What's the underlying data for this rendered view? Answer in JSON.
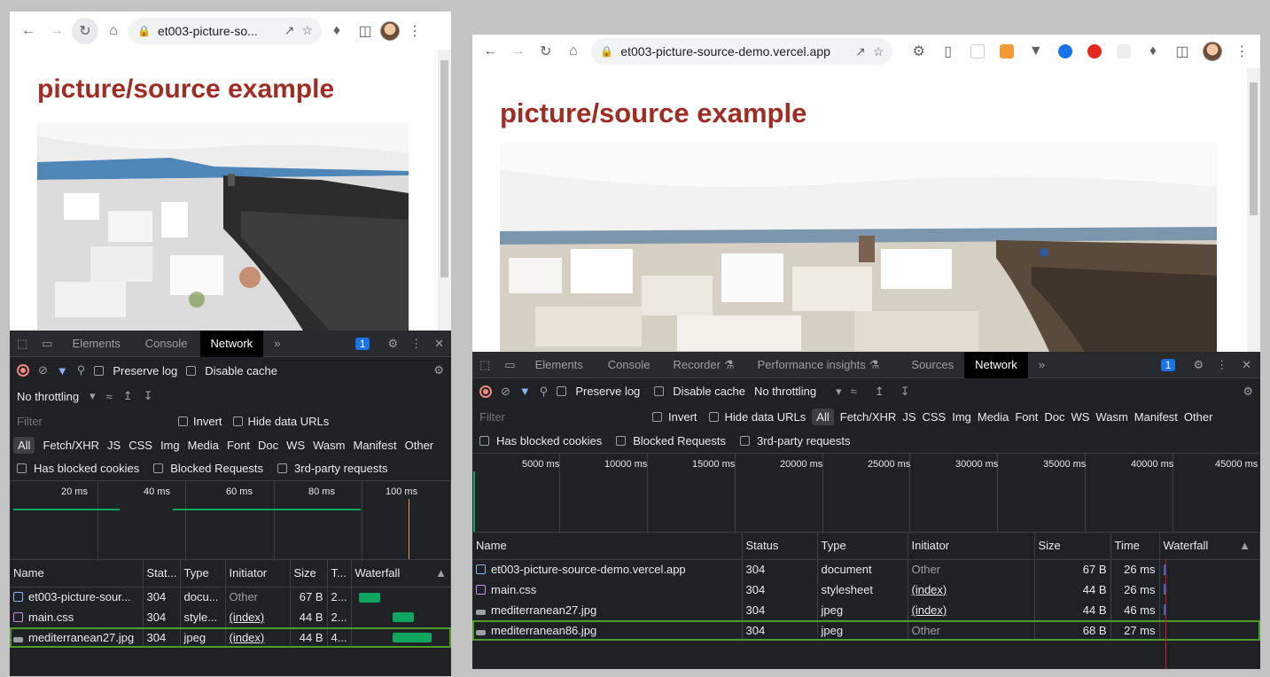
{
  "left": {
    "url": "et003-picture-so...",
    "heading": "picture/source example",
    "devtools": {
      "tabs": [
        "Elements",
        "Console",
        "Network"
      ],
      "issues_count": "1",
      "preserve_log": "Preserve log",
      "disable_cache": "Disable cache",
      "throttling": "No throttling",
      "filter_placeholder": "Filter",
      "invert": "Invert",
      "hide_data_urls": "Hide data URLs",
      "types": [
        "All",
        "Fetch/XHR",
        "JS",
        "CSS",
        "Img",
        "Media",
        "Font",
        "Doc",
        "WS",
        "Wasm",
        "Manifest",
        "Other"
      ],
      "has_blocked_cookies": "Has blocked cookies",
      "blocked_requests": "Blocked Requests",
      "third_party": "3rd-party requests",
      "timeline_ticks": [
        "20 ms",
        "40 ms",
        "60 ms",
        "80 ms",
        "100 ms"
      ],
      "columns": [
        "Name",
        "Stat...",
        "Type",
        "Initiator",
        "Size",
        "T...",
        "Waterfall"
      ],
      "rows": [
        {
          "name": "et003-picture-sour...",
          "status": "304",
          "type": "docu...",
          "initiator": "Other",
          "size": "67 B",
          "time": "2...",
          "icon": "document-icon"
        },
        {
          "name": "main.css",
          "status": "304",
          "type": "style...",
          "initiator": "(index)",
          "size": "44 B",
          "time": "2...",
          "icon": "stylesheet-icon"
        },
        {
          "name": "mediterranean27.jpg",
          "status": "304",
          "type": "jpeg",
          "initiator": "(index)",
          "size": "44 B",
          "time": "4...",
          "icon": "image-icon"
        }
      ]
    }
  },
  "right": {
    "url": "et003-picture-source-demo.vercel.app",
    "heading": "picture/source example",
    "devtools": {
      "tabs": [
        "Elements",
        "Console",
        "Recorder",
        "Performance insights",
        "Sources",
        "Network"
      ],
      "issues_count": "1",
      "preserve_log": "Preserve log",
      "disable_cache": "Disable cache",
      "throttling": "No throttling",
      "filter_placeholder": "Filter",
      "invert": "Invert",
      "hide_data_urls": "Hide data URLs",
      "types": [
        "All",
        "Fetch/XHR",
        "JS",
        "CSS",
        "Img",
        "Media",
        "Font",
        "Doc",
        "WS",
        "Wasm",
        "Manifest",
        "Other"
      ],
      "has_blocked_cookies": "Has blocked cookies",
      "blocked_requests": "Blocked Requests",
      "third_party": "3rd-party requests",
      "timeline_ticks": [
        "5000 ms",
        "10000 ms",
        "15000 ms",
        "20000 ms",
        "25000 ms",
        "30000 ms",
        "35000 ms",
        "40000 ms",
        "45000 ms"
      ],
      "columns": [
        "Name",
        "Status",
        "Type",
        "Initiator",
        "Size",
        "Time",
        "Waterfall"
      ],
      "rows": [
        {
          "name": "et003-picture-source-demo.vercel.app",
          "status": "304",
          "type": "document",
          "initiator": "Other",
          "size": "67 B",
          "time": "26 ms",
          "icon": "document-icon"
        },
        {
          "name": "main.css",
          "status": "304",
          "type": "stylesheet",
          "initiator": "(index)",
          "size": "44 B",
          "time": "26 ms",
          "icon": "stylesheet-icon"
        },
        {
          "name": "mediterranean27.jpg",
          "status": "304",
          "type": "jpeg",
          "initiator": "(index)",
          "size": "44 B",
          "time": "46 ms",
          "icon": "image-icon"
        },
        {
          "name": "mediterranean86.jpg",
          "status": "304",
          "type": "jpeg",
          "initiator": "Other",
          "size": "68 B",
          "time": "27 ms",
          "icon": "image-icon"
        }
      ]
    }
  },
  "colors": {
    "heading": "#a02d24",
    "highlight": "#4e9a2a",
    "record": "#f28b82",
    "waterfall": "#0ea55e"
  }
}
